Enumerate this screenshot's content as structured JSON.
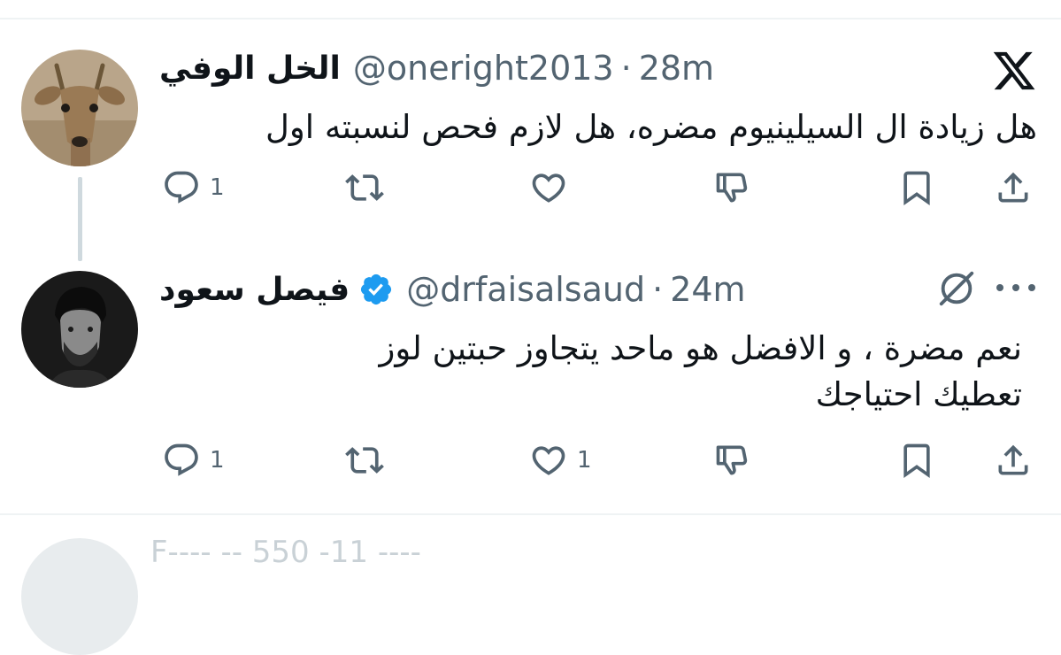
{
  "tweets": [
    {
      "display_name": "الخل الوفي",
      "handle": "@oneright2013",
      "separator": "·",
      "time": "28m",
      "text_lines": [
        "هل زيادة ال السيلينيوم مضره، هل لازم فحص لنسبته اول"
      ],
      "actions": {
        "reply_count": "1",
        "retweet_count": "",
        "like_count": "",
        "dislike_count": "",
        "bookmark_count": "",
        "share_count": ""
      }
    },
    {
      "display_name": "فيصل سعود",
      "handle": "@drfaisalsaud",
      "separator": "·",
      "time": "24m",
      "verified": true,
      "text_lines": [
        "نعم مضرة ، و الافضل هو ماحد يتجاوز حبتين لوز",
        "تعطيك احتياجك"
      ],
      "actions": {
        "reply_count": "1",
        "retweet_count": "",
        "like_count": "1",
        "dislike_count": "",
        "bookmark_count": "",
        "share_count": ""
      }
    }
  ],
  "icons": {
    "brand": "x-logo-icon",
    "reply": "reply-icon",
    "retweet": "retweet-icon",
    "like": "heart-icon",
    "dislike": "thumbs-down-icon",
    "bookmark": "bookmark-icon",
    "share": "share-icon",
    "grok": "grok-icon",
    "more": "more-icon",
    "verified": "verified-badge-icon"
  },
  "colors": {
    "text": "#0f1419",
    "secondary": "#536471",
    "verified": "#1d9bf0",
    "divider": "#eff3f4",
    "thread_line": "#cfd9de"
  },
  "next_tweet_peek": {
    "text": "F---- -- 550 -11 ----"
  }
}
